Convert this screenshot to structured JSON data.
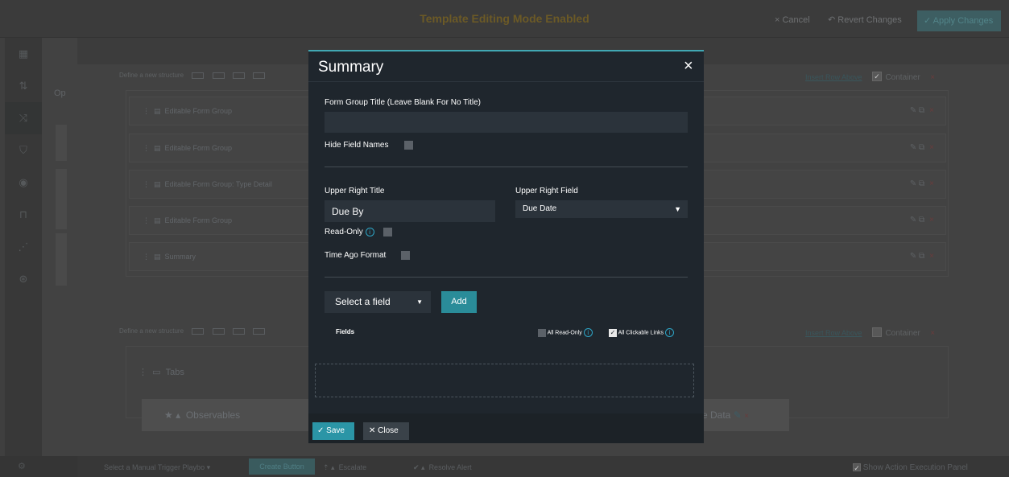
{
  "banner": {
    "title": "Template Editing Mode Enabled",
    "cancel": "× Cancel",
    "revert": "↶ Revert Changes",
    "apply": "✓ Apply Changes"
  },
  "builder": {
    "op_label": "Op",
    "define_structure": "Define a new structure",
    "insert_row_above": "Insert Row Above",
    "container": "Container",
    "rows": [
      "Editable Form Group",
      "Editable Form Group",
      "Editable Form Group: Type Detail",
      "Editable Form Group",
      "Summary"
    ],
    "tabs_label": "Tabs",
    "observables_tab": "Observables",
    "data_tab_partial": "e Data"
  },
  "bottom": {
    "playbook_select": "Select a Manual Trigger Playbo",
    "create_button": "Create Button",
    "escalate": "Escalate",
    "resolve": "Resolve Alert",
    "show_panel": "Show Action Execution Panel"
  },
  "modal": {
    "title": "Summary",
    "close_icon": "×",
    "form_group_title_label": "Form Group Title (Leave Blank For No Title)",
    "form_group_title_value": "",
    "hide_field_names": "Hide Field Names",
    "upper_right_title_label": "Upper Right Title",
    "upper_right_title_value": "Due By",
    "upper_right_field_label": "Upper Right Field",
    "upper_right_field_value": "Due Date",
    "read_only": "Read-Only",
    "time_ago_format": "Time Ago Format",
    "select_field": "Select a field",
    "add_button": "Add",
    "fields_label": "Fields",
    "all_read_only": "All Read-Only",
    "all_clickable_links": "All Clickable Links",
    "save_button": "Save",
    "close_button": "Close"
  }
}
